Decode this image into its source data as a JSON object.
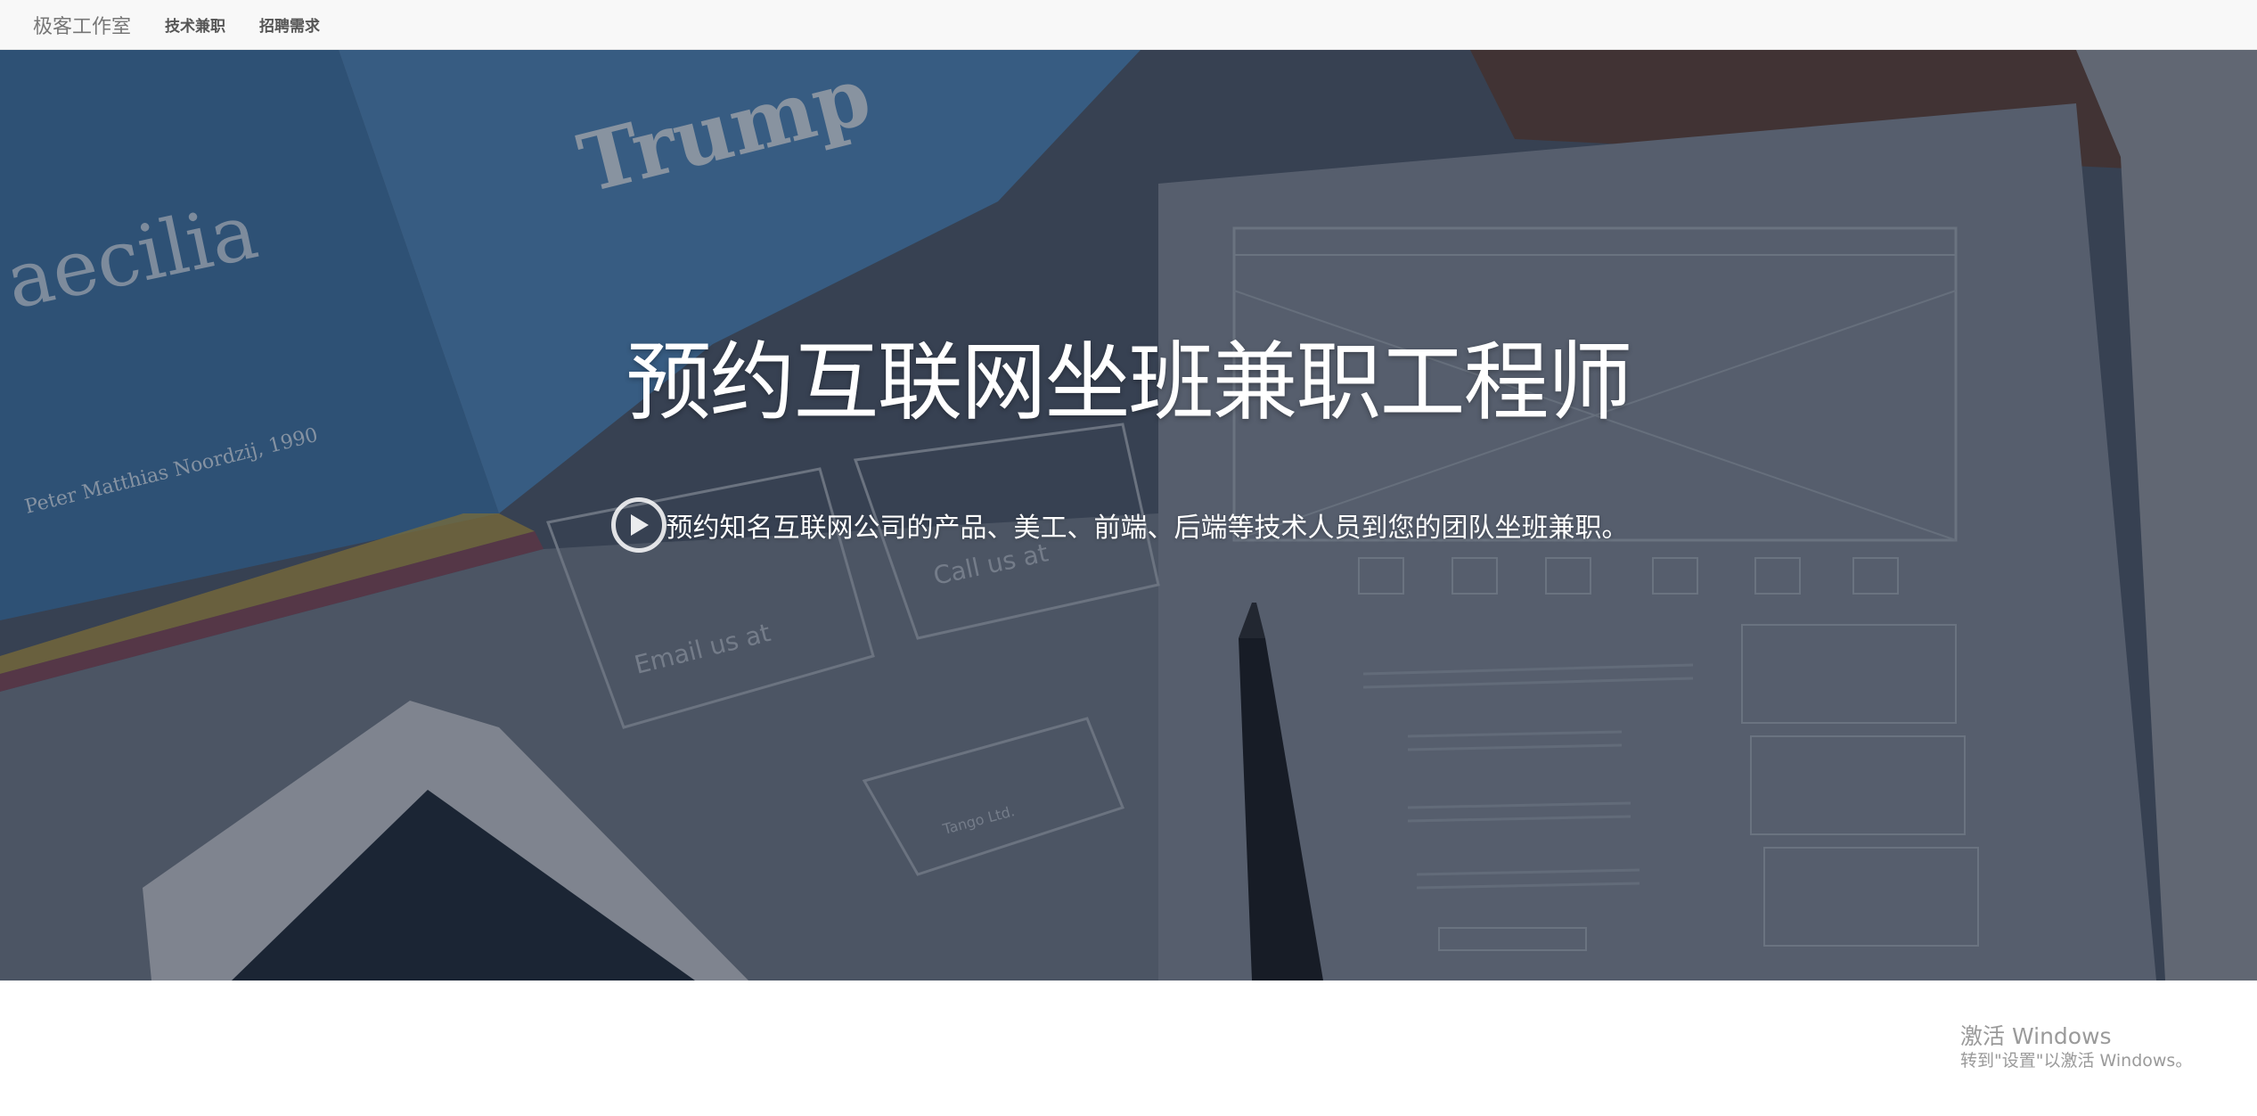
{
  "navbar": {
    "brand": "极客工作室",
    "links": [
      {
        "label": "技术兼职"
      },
      {
        "label": "招聘需求"
      }
    ]
  },
  "hero": {
    "title": "预约互联网坐班兼职工程师",
    "subtitle": "预约知名互联网公司的产品、美工、前端、后端等技术人员到您的团队坐班兼职。",
    "play_icon": "play-circle-icon",
    "background_book_text": [
      "aecilia",
      "Trump",
      "Peter Matthias Noordzij, 1990"
    ],
    "background_card_text": [
      "Email us at",
      "Call us at",
      "Tango Ltd."
    ]
  },
  "watermark": {
    "title": "激活 Windows",
    "subtitle": "转到\"设置\"以激活 Windows。"
  },
  "colors": {
    "navbar_bg": "#f8f8f8",
    "brand": "#777777",
    "nav_link": "#555555",
    "hero_overlay": "#3d4a5c",
    "hero_text": "#ffffff",
    "watermark": "#9a9a9a"
  }
}
